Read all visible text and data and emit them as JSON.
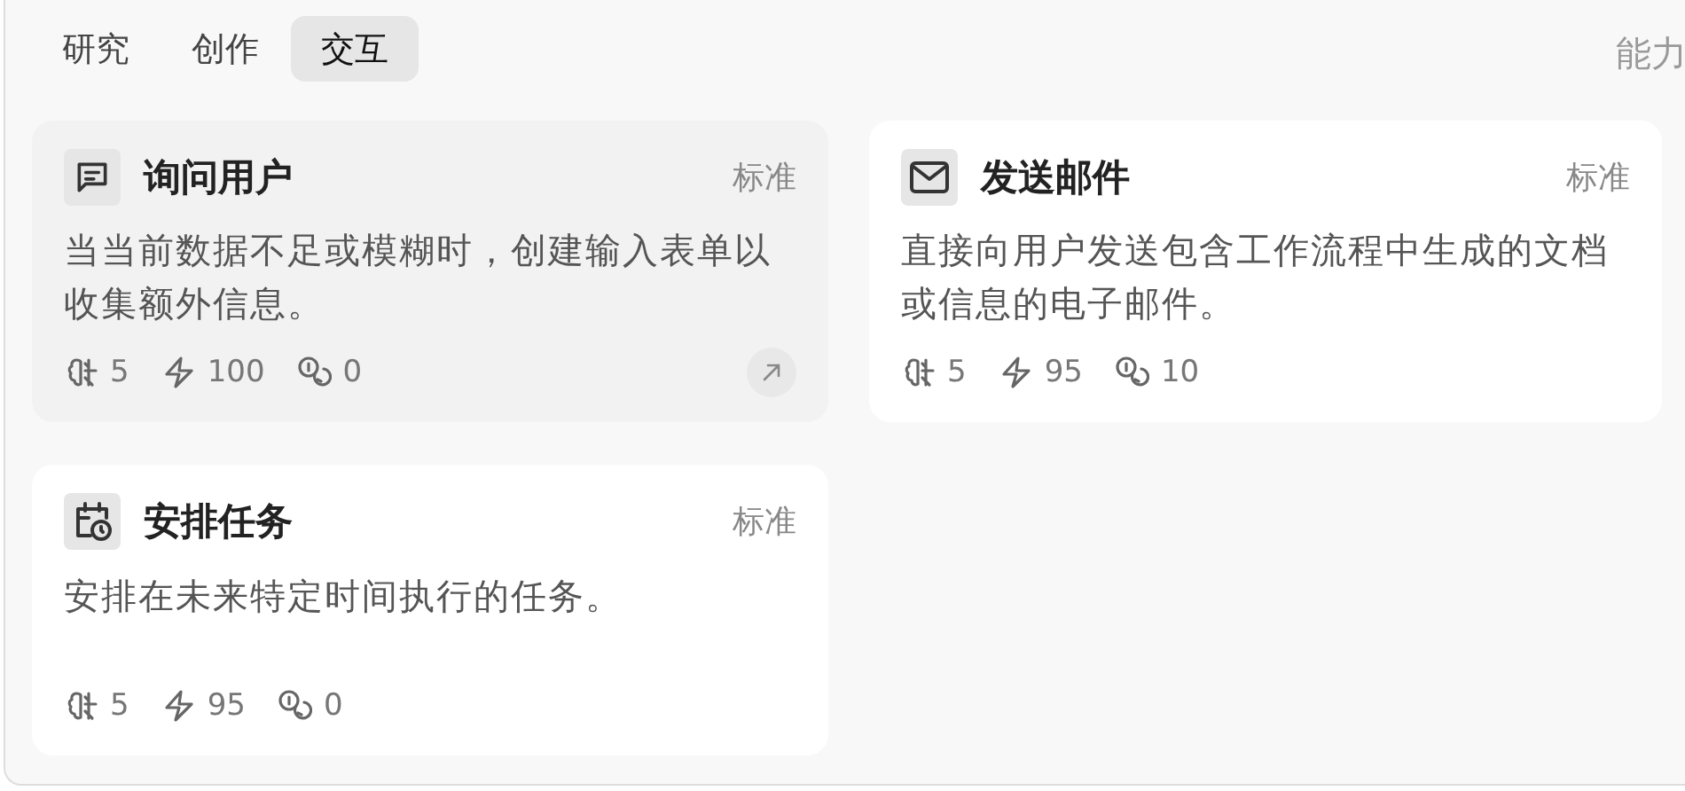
{
  "tabs": [
    {
      "label": "研究",
      "selected": false
    },
    {
      "label": "创作",
      "selected": false
    },
    {
      "label": "交互",
      "selected": true
    }
  ],
  "header_right": "能力",
  "cards": [
    {
      "kind": "chat",
      "title": "询问用户",
      "tier": "标准",
      "description": "当当前数据不足或模糊时，创建输入表单以收集额外信息。",
      "highlighted": true,
      "stats": [
        {
          "kind": "brain",
          "value": "5"
        },
        {
          "kind": "bolt",
          "value": "100"
        },
        {
          "kind": "coins",
          "value": "0"
        }
      ]
    },
    {
      "kind": "mail",
      "title": "发送邮件",
      "tier": "标准",
      "description": "直接向用户发送包含工作流程中生成的文档或信息的电子邮件。",
      "highlighted": false,
      "stats": [
        {
          "kind": "brain",
          "value": "5"
        },
        {
          "kind": "bolt",
          "value": "95"
        },
        {
          "kind": "coins",
          "value": "10"
        }
      ]
    },
    {
      "kind": "calendar",
      "title": "安排任务",
      "tier": "标准",
      "description": "安排在未来特定时间执行的任务。",
      "highlighted": false,
      "stats": [
        {
          "kind": "brain",
          "value": "5"
        },
        {
          "kind": "bolt",
          "value": "95"
        },
        {
          "kind": "coins",
          "value": "0"
        }
      ]
    }
  ]
}
